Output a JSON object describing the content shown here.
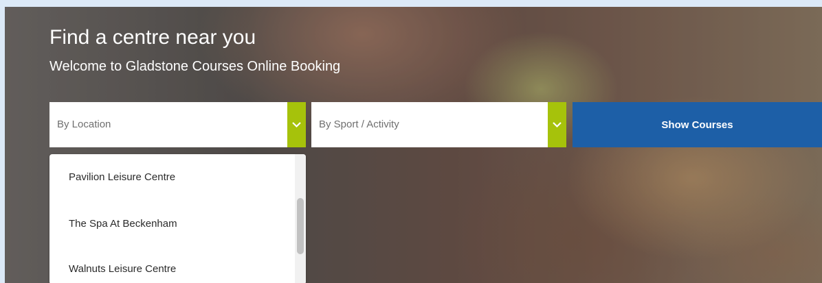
{
  "hero": {
    "title": "Find a centre near you",
    "subtitle": "Welcome to Gladstone Courses Online Booking"
  },
  "search": {
    "location": {
      "placeholder": "By Location",
      "icon": "chevron-down-icon"
    },
    "sport": {
      "placeholder": "By Sport / Activity",
      "icon": "chevron-down-icon"
    },
    "submit_label": "Show Courses"
  },
  "dropdown": {
    "items": [
      "Pavilion Leisure Centre",
      "The Spa At Beckenham",
      "Walnuts Leisure Centre"
    ]
  },
  "colors": {
    "accent_green": "#a6c20b",
    "button_blue": "#1d5fa7",
    "page_background": "#dce9f7"
  }
}
